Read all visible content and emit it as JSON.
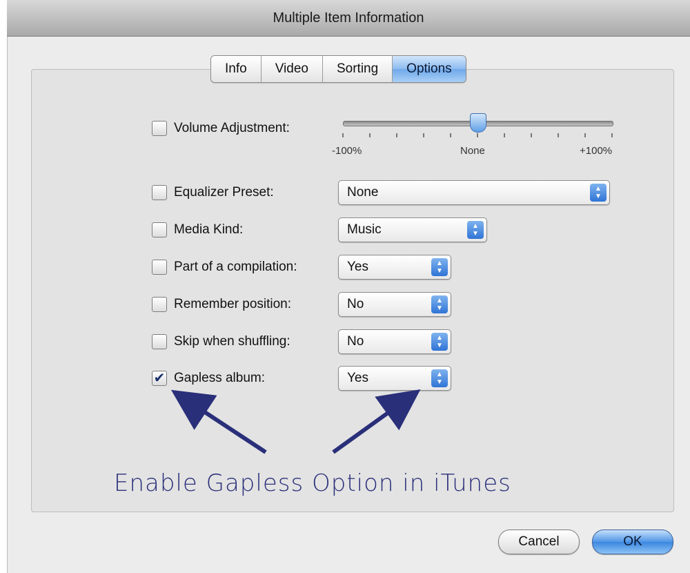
{
  "window": {
    "title": "Multiple Item Information"
  },
  "tabs": [
    {
      "label": "Info",
      "active": false
    },
    {
      "label": "Video",
      "active": false
    },
    {
      "label": "Sorting",
      "active": false
    },
    {
      "label": "Options",
      "active": true
    }
  ],
  "volume": {
    "label": "Volume Adjustment:",
    "checked": false,
    "value_percent": 0,
    "range": [
      -100,
      100
    ],
    "tick_labels": {
      "min": "-100%",
      "mid": "None",
      "max": "+100%"
    }
  },
  "fields": [
    {
      "id": "equalizer",
      "label": "Equalizer Preset:",
      "checked": false,
      "value": "None"
    },
    {
      "id": "media-kind",
      "label": "Media Kind:",
      "checked": false,
      "value": "Music"
    },
    {
      "id": "compilation",
      "label": "Part of a compilation:",
      "checked": false,
      "value": "Yes"
    },
    {
      "id": "remember",
      "label": "Remember position:",
      "checked": false,
      "value": "No"
    },
    {
      "id": "skip",
      "label": "Skip when shuffling:",
      "checked": false,
      "value": "No"
    },
    {
      "id": "gapless",
      "label": "Gapless album:",
      "checked": true,
      "value": "Yes"
    }
  ],
  "annotation": {
    "text": "Enable Gapless Option in iTunes",
    "color": "#2a2f7a"
  },
  "buttons": {
    "cancel": "Cancel",
    "ok": "OK"
  },
  "colors": {
    "accent": "#4f95e6",
    "annotation": "#2a2f7a"
  },
  "icons": {
    "check": "checkmark-icon",
    "popup": "updown-arrows-icon"
  }
}
